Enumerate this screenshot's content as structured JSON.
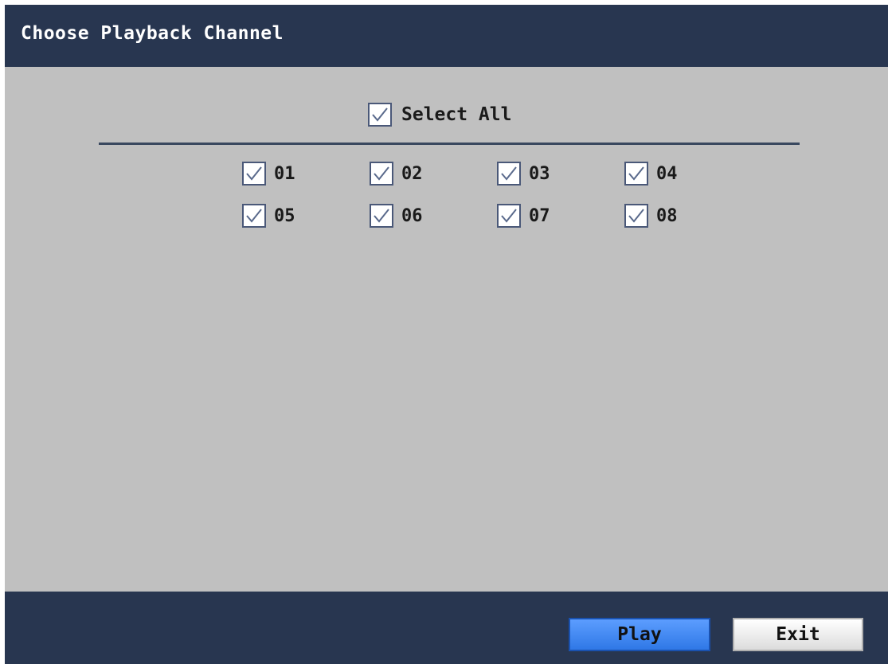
{
  "dialog": {
    "title": "Choose Playback Channel"
  },
  "select_all": {
    "label": "Select All",
    "checked": true
  },
  "channels": [
    {
      "label": "01",
      "checked": true
    },
    {
      "label": "02",
      "checked": true
    },
    {
      "label": "03",
      "checked": true
    },
    {
      "label": "04",
      "checked": true
    },
    {
      "label": "05",
      "checked": true
    },
    {
      "label": "06",
      "checked": true
    },
    {
      "label": "07",
      "checked": true
    },
    {
      "label": "08",
      "checked": true
    }
  ],
  "buttons": {
    "play_label": "Play",
    "exit_label": "Exit"
  },
  "colors": {
    "title_bar": "#283650",
    "content_bg": "#c0c0c0",
    "play_button": "#3f88f5",
    "checkbox_border": "#4a5878"
  },
  "icons": {
    "checkbox": "checkmark-icon"
  }
}
